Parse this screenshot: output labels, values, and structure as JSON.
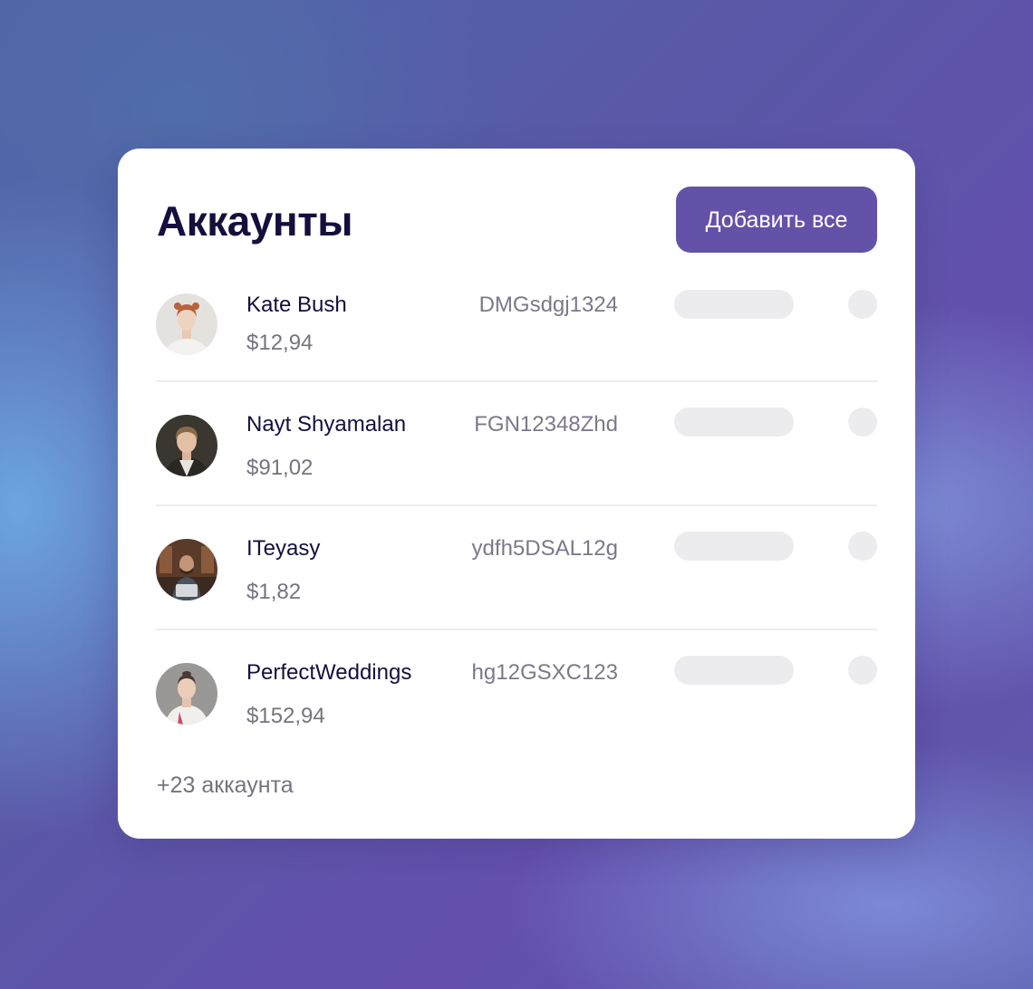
{
  "card": {
    "title": "Аккаунты",
    "add_all_label": "Добавить все",
    "more_accounts": "+23 аккаунта"
  },
  "accounts": [
    {
      "name": "Kate Bush",
      "amount": "$12,94",
      "code": "DMGsdgj1324"
    },
    {
      "name": "Nayt Shyamalan",
      "amount": "$91,02",
      "code": "FGN12348Zhd"
    },
    {
      "name": "ITeyasy",
      "amount": "$1,82",
      "code": "ydfh5DSAL12g"
    },
    {
      "name": "PerfectWeddings",
      "amount": "$152,94",
      "code": "hg12GSXC123"
    }
  ],
  "colors": {
    "accent": "#6451a8",
    "title": "#140f3d",
    "muted": "#77727f",
    "placeholder": "#ececee"
  }
}
